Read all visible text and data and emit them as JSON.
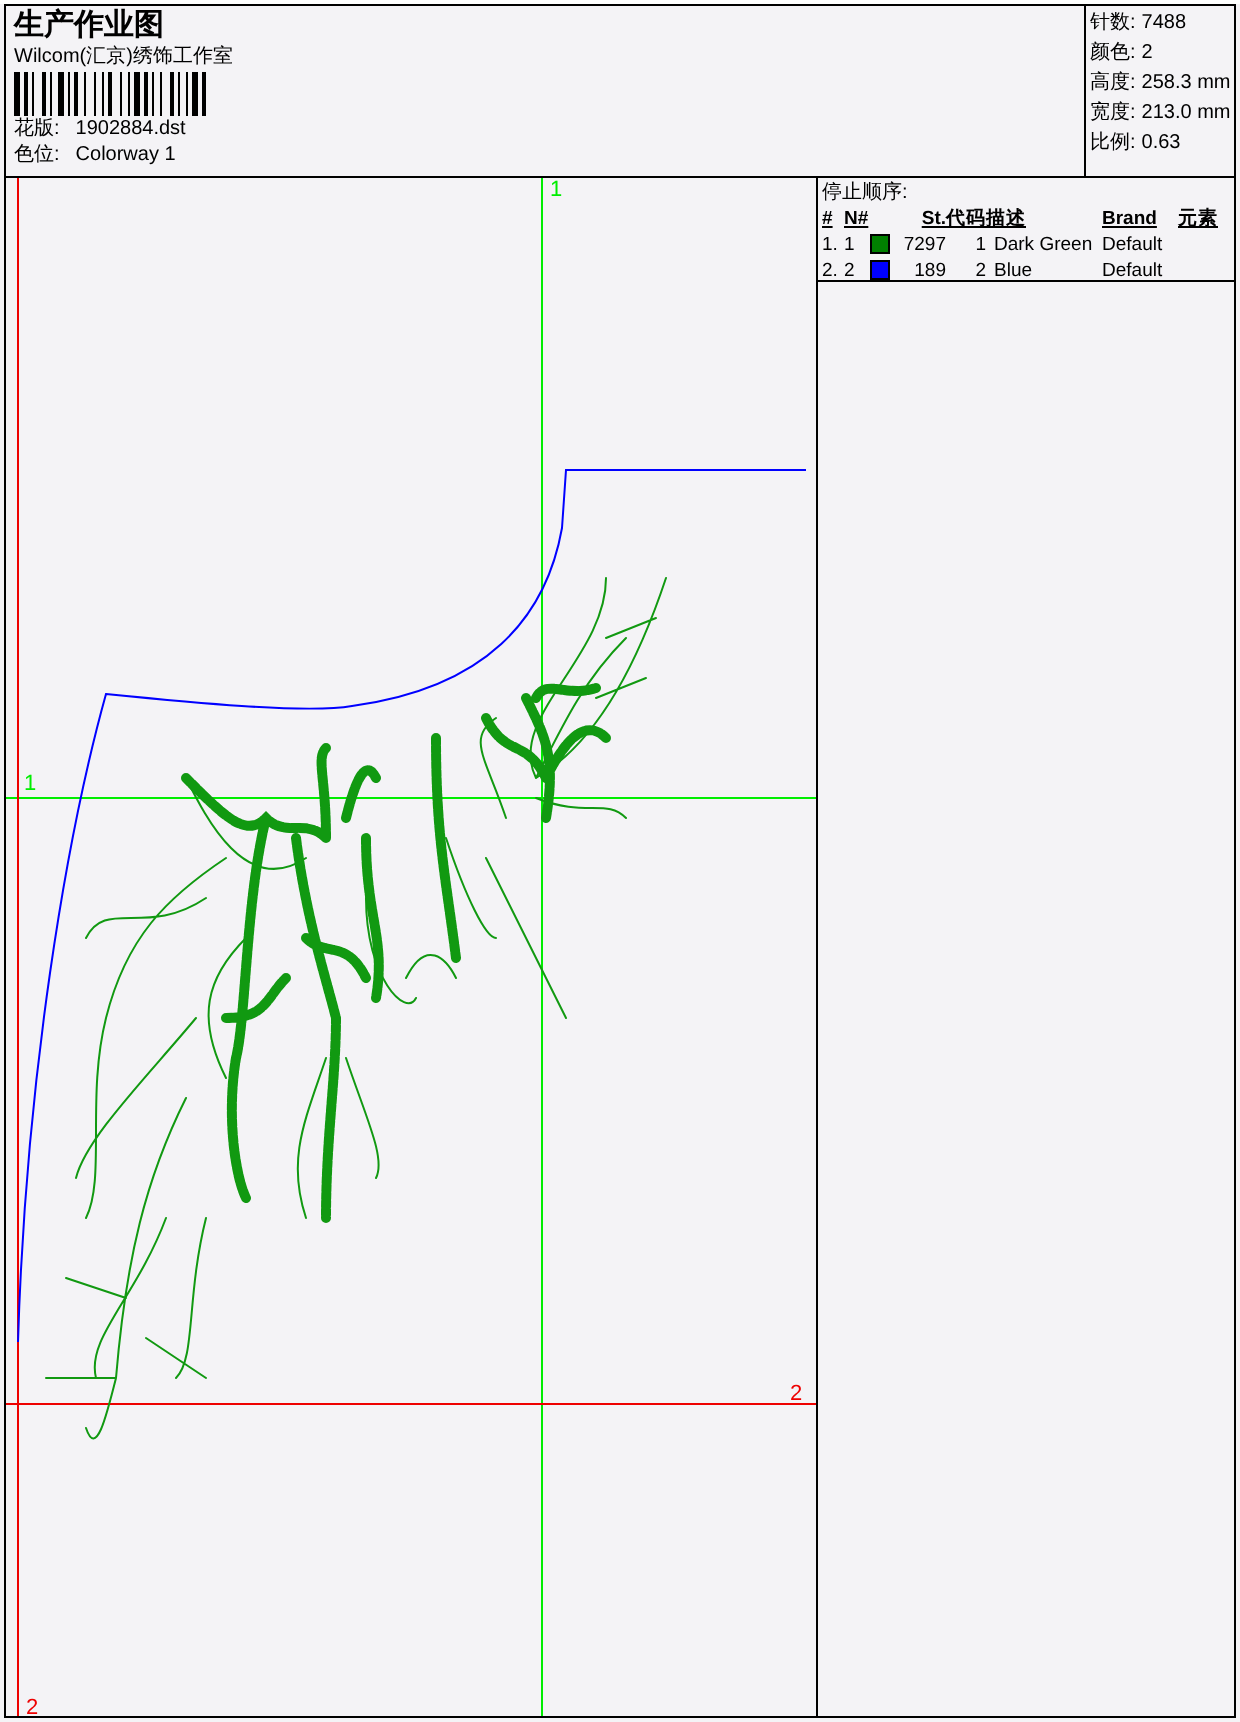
{
  "header": {
    "title": "生产作业图",
    "company": "Wilcom(汇京)绣饰工作室",
    "design_label": "花版:",
    "design_value": "1902884.dst",
    "colorway_label": "色位:",
    "colorway_value": "Colorway 1"
  },
  "stats": [
    {
      "label": "针数:",
      "value": "7488"
    },
    {
      "label": "颜色:",
      "value": "2"
    },
    {
      "label": "高度:",
      "value": "258.3 mm"
    },
    {
      "label": "宽度:",
      "value": "213.0 mm"
    },
    {
      "label": "比例:",
      "value": "0.63"
    }
  ],
  "stop_sequence": {
    "title": "停止顺序:",
    "columns": [
      "#",
      "N#",
      "St.",
      "代码",
      "描述",
      "Brand",
      "元素"
    ],
    "rows": [
      {
        "index": "1.",
        "number": "1",
        "color": "#008000",
        "stitches": "7297",
        "code": "1",
        "description": "Dark Green",
        "brand": "Default"
      },
      {
        "index": "2.",
        "number": "2",
        "color": "#0000ff",
        "stitches": "189",
        "code": "2",
        "description": "Blue",
        "brand": "Default"
      }
    ]
  },
  "guides": [
    {
      "kind": "vertical",
      "label": "1",
      "color": "#00ee00"
    },
    {
      "kind": "horizontal",
      "label": "1",
      "color": "#00ee00"
    },
    {
      "kind": "horizontal",
      "label": "2",
      "color": "#ee0000"
    },
    {
      "kind": "vertical",
      "label": "2",
      "color": "#ee0000"
    }
  ]
}
